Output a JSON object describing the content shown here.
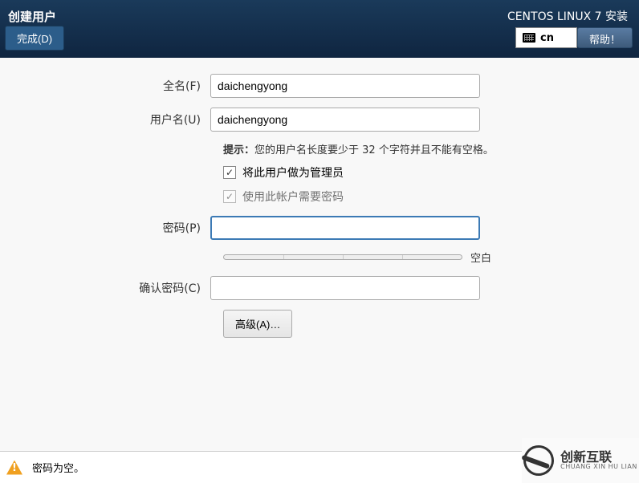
{
  "header": {
    "title": "创建用户",
    "product_label": "CENTOS LINUX 7 安装",
    "done_button_label": "完成(D)",
    "lang_layout": "cn",
    "help_button_label": "帮助！"
  },
  "form": {
    "fullname_label": "全名(F)",
    "fullname_value": "daichengyong",
    "username_label": "用户名(U)",
    "username_value": "daichengyong",
    "hint_prefix": "提示：",
    "hint_text": "您的用户名长度要少于 32 个字符并且不能有空格。",
    "admin_checkbox_label": "将此用户做为管理员",
    "admin_checked": true,
    "require_pw_checkbox_label": "使用此帐户需要密码",
    "require_pw_checked": true,
    "password_label": "密码(P)",
    "password_value": "",
    "password_strength_label": "空白",
    "confirm_label": "确认密码(C)",
    "confirm_value": "",
    "advanced_button_label": "高级(A)…"
  },
  "status": {
    "message": "密码为空。"
  },
  "watermark": {
    "cn": "创新互联",
    "en": "CHUANG XIN HU LIAN"
  }
}
